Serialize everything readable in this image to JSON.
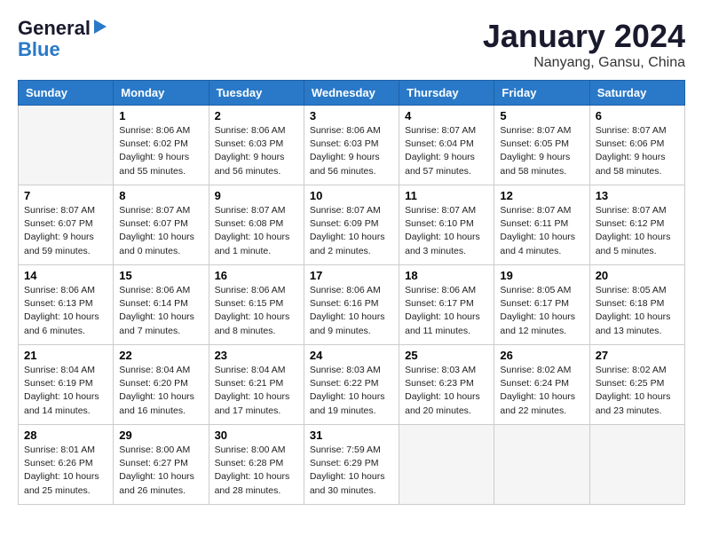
{
  "logo": {
    "line1": "General",
    "line2": "Blue"
  },
  "title": "January 2024",
  "subtitle": "Nanyang, Gansu, China",
  "weekdays": [
    "Sunday",
    "Monday",
    "Tuesday",
    "Wednesday",
    "Thursday",
    "Friday",
    "Saturday"
  ],
  "weeks": [
    [
      {
        "num": "",
        "info": ""
      },
      {
        "num": "1",
        "info": "Sunrise: 8:06 AM\nSunset: 6:02 PM\nDaylight: 9 hours\nand 55 minutes."
      },
      {
        "num": "2",
        "info": "Sunrise: 8:06 AM\nSunset: 6:03 PM\nDaylight: 9 hours\nand 56 minutes."
      },
      {
        "num": "3",
        "info": "Sunrise: 8:06 AM\nSunset: 6:03 PM\nDaylight: 9 hours\nand 56 minutes."
      },
      {
        "num": "4",
        "info": "Sunrise: 8:07 AM\nSunset: 6:04 PM\nDaylight: 9 hours\nand 57 minutes."
      },
      {
        "num": "5",
        "info": "Sunrise: 8:07 AM\nSunset: 6:05 PM\nDaylight: 9 hours\nand 58 minutes."
      },
      {
        "num": "6",
        "info": "Sunrise: 8:07 AM\nSunset: 6:06 PM\nDaylight: 9 hours\nand 58 minutes."
      }
    ],
    [
      {
        "num": "7",
        "info": "Sunrise: 8:07 AM\nSunset: 6:07 PM\nDaylight: 9 hours\nand 59 minutes."
      },
      {
        "num": "8",
        "info": "Sunrise: 8:07 AM\nSunset: 6:07 PM\nDaylight: 10 hours\nand 0 minutes."
      },
      {
        "num": "9",
        "info": "Sunrise: 8:07 AM\nSunset: 6:08 PM\nDaylight: 10 hours\nand 1 minute."
      },
      {
        "num": "10",
        "info": "Sunrise: 8:07 AM\nSunset: 6:09 PM\nDaylight: 10 hours\nand 2 minutes."
      },
      {
        "num": "11",
        "info": "Sunrise: 8:07 AM\nSunset: 6:10 PM\nDaylight: 10 hours\nand 3 minutes."
      },
      {
        "num": "12",
        "info": "Sunrise: 8:07 AM\nSunset: 6:11 PM\nDaylight: 10 hours\nand 4 minutes."
      },
      {
        "num": "13",
        "info": "Sunrise: 8:07 AM\nSunset: 6:12 PM\nDaylight: 10 hours\nand 5 minutes."
      }
    ],
    [
      {
        "num": "14",
        "info": "Sunrise: 8:06 AM\nSunset: 6:13 PM\nDaylight: 10 hours\nand 6 minutes."
      },
      {
        "num": "15",
        "info": "Sunrise: 8:06 AM\nSunset: 6:14 PM\nDaylight: 10 hours\nand 7 minutes."
      },
      {
        "num": "16",
        "info": "Sunrise: 8:06 AM\nSunset: 6:15 PM\nDaylight: 10 hours\nand 8 minutes."
      },
      {
        "num": "17",
        "info": "Sunrise: 8:06 AM\nSunset: 6:16 PM\nDaylight: 10 hours\nand 9 minutes."
      },
      {
        "num": "18",
        "info": "Sunrise: 8:06 AM\nSunset: 6:17 PM\nDaylight: 10 hours\nand 11 minutes."
      },
      {
        "num": "19",
        "info": "Sunrise: 8:05 AM\nSunset: 6:17 PM\nDaylight: 10 hours\nand 12 minutes."
      },
      {
        "num": "20",
        "info": "Sunrise: 8:05 AM\nSunset: 6:18 PM\nDaylight: 10 hours\nand 13 minutes."
      }
    ],
    [
      {
        "num": "21",
        "info": "Sunrise: 8:04 AM\nSunset: 6:19 PM\nDaylight: 10 hours\nand 14 minutes."
      },
      {
        "num": "22",
        "info": "Sunrise: 8:04 AM\nSunset: 6:20 PM\nDaylight: 10 hours\nand 16 minutes."
      },
      {
        "num": "23",
        "info": "Sunrise: 8:04 AM\nSunset: 6:21 PM\nDaylight: 10 hours\nand 17 minutes."
      },
      {
        "num": "24",
        "info": "Sunrise: 8:03 AM\nSunset: 6:22 PM\nDaylight: 10 hours\nand 19 minutes."
      },
      {
        "num": "25",
        "info": "Sunrise: 8:03 AM\nSunset: 6:23 PM\nDaylight: 10 hours\nand 20 minutes."
      },
      {
        "num": "26",
        "info": "Sunrise: 8:02 AM\nSunset: 6:24 PM\nDaylight: 10 hours\nand 22 minutes."
      },
      {
        "num": "27",
        "info": "Sunrise: 8:02 AM\nSunset: 6:25 PM\nDaylight: 10 hours\nand 23 minutes."
      }
    ],
    [
      {
        "num": "28",
        "info": "Sunrise: 8:01 AM\nSunset: 6:26 PM\nDaylight: 10 hours\nand 25 minutes."
      },
      {
        "num": "29",
        "info": "Sunrise: 8:00 AM\nSunset: 6:27 PM\nDaylight: 10 hours\nand 26 minutes."
      },
      {
        "num": "30",
        "info": "Sunrise: 8:00 AM\nSunset: 6:28 PM\nDaylight: 10 hours\nand 28 minutes."
      },
      {
        "num": "31",
        "info": "Sunrise: 7:59 AM\nSunset: 6:29 PM\nDaylight: 10 hours\nand 30 minutes."
      },
      {
        "num": "",
        "info": ""
      },
      {
        "num": "",
        "info": ""
      },
      {
        "num": "",
        "info": ""
      }
    ]
  ]
}
